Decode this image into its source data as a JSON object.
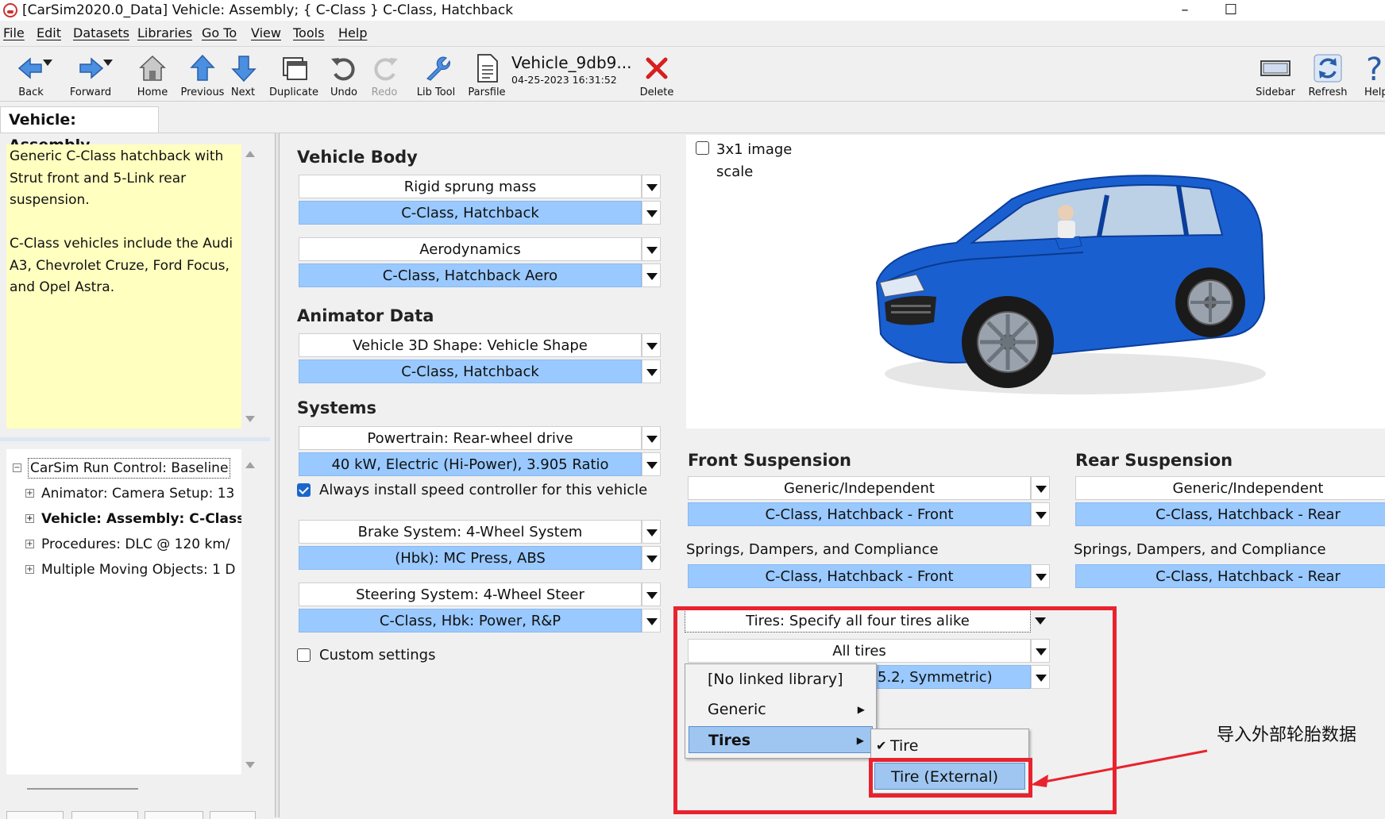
{
  "window": {
    "title": "[CarSim2020.0_Data] Vehicle: Assembly; { C-Class } C-Class, Hatchback"
  },
  "menu": [
    "File",
    "Edit",
    "Datasets",
    "Libraries",
    "Go To",
    "View",
    "Tools",
    "Help"
  ],
  "toolbar": {
    "back": "Back",
    "forward": "Forward",
    "home": "Home",
    "previous": "Previous",
    "next": "Next",
    "duplicate": "Duplicate",
    "undo": "Undo",
    "redo": "Redo",
    "libtool": "Lib Tool",
    "parsfile": "Parsfile",
    "dataset_name": "Vehicle_9db9...",
    "dataset_date": "04-25-2023 16:31:52",
    "delete": "Delete",
    "sidebar": "Sidebar",
    "refresh": "Refresh",
    "help": "Help"
  },
  "tab": {
    "title": "Vehicle: Assembly"
  },
  "notes": "Generic C-Class hatchback with\nStrut front and 5-Link rear\nsuspension.\n\nC-Class vehicles include the Audi\nA3, Chevrolet Cruze, Ford Focus,\nand Opel Astra.",
  "tree": {
    "items": [
      "CarSim Run Control: Baseline",
      "Animator: Camera Setup: 13",
      "Vehicle: Assembly: C-Class",
      "Procedures: DLC @ 120 km/",
      "Multiple Moving Objects: 1 D"
    ]
  },
  "body": {
    "title": "Vehicle Body",
    "sprung_type": "Rigid sprung mass",
    "sprung_value": "C-Class, Hatchback",
    "aero_type": "Aerodynamics",
    "aero_value": "C-Class, Hatchback Aero"
  },
  "animator": {
    "title": "Animator Data",
    "shape_type": "Vehicle 3D Shape: Vehicle Shape",
    "shape_value": "C-Class, Hatchback"
  },
  "systems": {
    "title": "Systems",
    "powertrain_type": "Powertrain: Rear-wheel drive",
    "powertrain_value": "40 kW, Electric (Hi-Power), 3.905 Ratio",
    "speed_ctrl": "Always install speed controller for this vehicle",
    "brake_type": "Brake System: 4-Wheel System",
    "brake_value": "(Hbk): MC Press, ABS",
    "steer_type": "Steering System: 4-Wheel Steer",
    "steer_value": "C-Class, Hbk: Power, R&P",
    "custom": "Custom settings"
  },
  "image": {
    "scale_label": "3x1 image scale",
    "scale_l1": "3x1 image",
    "scale_l2": "scale",
    "car_color": "#1a5fd0"
  },
  "front": {
    "title": "Front Suspension",
    "type": "Generic/Independent",
    "value": "C-Class, Hatchback - Front",
    "springs_title": "Springs, Dampers, and Compliance",
    "springs_value": "C-Class, Hatchback - Front"
  },
  "rear": {
    "title": "Rear Suspension",
    "type": "Generic/Independent",
    "value": "C-Class, Hatchback - Rear",
    "springs_title": "Springs, Dampers, and Compliance",
    "springs_value": "C-Class, Hatchback - Rear"
  },
  "tires": {
    "mode": "Tires: Specify all four tires alike",
    "which": "All tires",
    "value_partial": "5.2, Symmetric)"
  },
  "context_menu": {
    "items": [
      "[No linked library]",
      "Generic",
      "Tires"
    ],
    "submenu": [
      "Tire",
      "Tire (External)"
    ]
  },
  "annotation": {
    "text": "导入外部轮胎数据",
    "color": "#e8232e"
  }
}
